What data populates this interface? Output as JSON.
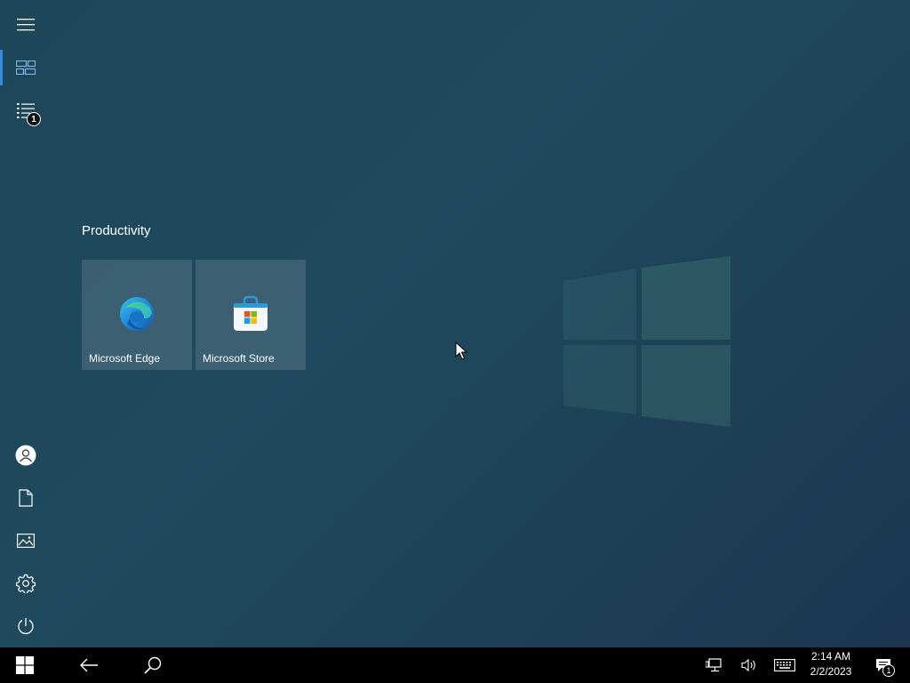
{
  "start_menu": {
    "rail": {
      "top_items": [
        {
          "icon": "hamburger-icon",
          "label": "Expand"
        },
        {
          "icon": "tiles-icon",
          "label": "Pinned tiles",
          "active": true
        },
        {
          "icon": "all-apps-icon",
          "label": "All apps",
          "badge": "1"
        }
      ],
      "bottom_items": [
        {
          "icon": "user-icon",
          "label": "Account"
        },
        {
          "icon": "document-icon",
          "label": "Documents"
        },
        {
          "icon": "pictures-icon",
          "label": "Pictures"
        },
        {
          "icon": "settings-icon",
          "label": "Settings"
        },
        {
          "icon": "power-icon",
          "label": "Power"
        }
      ]
    },
    "group": {
      "title": "Productivity",
      "tiles": [
        {
          "label": "Microsoft Edge",
          "icon": "edge-icon"
        },
        {
          "label": "Microsoft Store",
          "icon": "store-icon"
        }
      ]
    }
  },
  "taskbar": {
    "start_icon": "windows-logo-icon",
    "back_icon": "back-arrow-icon",
    "search_icon": "search-icon",
    "tray": {
      "network_icon": "network-icon",
      "volume_icon": "volume-icon",
      "keyboard_icon": "touch-keyboard-icon",
      "time": "2:14 AM",
      "date": "2/2/2023",
      "notification_icon": "action-center-icon",
      "notification_count": "1"
    }
  },
  "colors": {
    "accent": "#2f8be6",
    "taskbar": "#000000"
  }
}
